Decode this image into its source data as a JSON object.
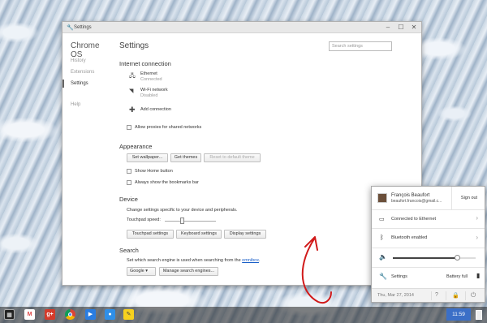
{
  "window": {
    "title": "Settings",
    "controls": {
      "minimize": "–",
      "maximize": "☐",
      "close": "✕"
    }
  },
  "sidebar": {
    "brand": "Chrome OS",
    "items": [
      {
        "label": "History",
        "active": false
      },
      {
        "label": "Extensions",
        "active": false
      },
      {
        "label": "Settings",
        "active": true
      },
      {
        "label": "Help",
        "active": false
      }
    ]
  },
  "main": {
    "title": "Settings",
    "search_placeholder": "Search settings",
    "internet": {
      "heading": "Internet connection",
      "ethernet_name": "Ethernet",
      "ethernet_status": "Connected",
      "wifi_name": "Wi-Fi network",
      "wifi_status": "Disabled",
      "add_connection": "Add connection",
      "allow_proxies": "Allow proxies for shared networks"
    },
    "appearance": {
      "heading": "Appearance",
      "set_wallpaper": "Set wallpaper...",
      "get_themes": "Get themes",
      "reset_theme": "Reset to default theme",
      "show_home": "Show Home button",
      "show_bookmarks": "Always show the bookmarks bar"
    },
    "device": {
      "heading": "Device",
      "description": "Change settings specific to your device and peripherals.",
      "touchpad_speed": "Touchpad speed:",
      "touchpad_speed_value": 0.35,
      "touchpad_settings": "Touchpad settings",
      "keyboard_settings": "Keyboard settings",
      "display_settings": "Display settings"
    },
    "search": {
      "heading": "Search",
      "description_prefix": "Set which search engine is used when searching from the ",
      "description_link": "omnibox",
      "description_suffix": ".",
      "engine": "Google",
      "manage": "Manage search engines..."
    }
  },
  "tray": {
    "user_name": "François Beaufort",
    "user_email": "beaufort.francois@gmail.c...",
    "sign_out": "Sign out",
    "ethernet": "Connected to Ethernet",
    "bluetooth": "Bluetooth enabled",
    "volume_level": 0.78,
    "settings": "Settings",
    "battery": "Battery full",
    "date": "Thu, Mar 27, 2014",
    "help_icon": "?",
    "power_icon": "⏻",
    "lock_icon": "🔒"
  },
  "shelf": {
    "time": "11:59",
    "apps": [
      "launcher",
      "gmail",
      "google-plus",
      "chrome",
      "video",
      "camera",
      "keep"
    ]
  },
  "colors": {
    "accent": "#3b6fc7",
    "arrow": "#d11a1a",
    "link": "#1a5fc8"
  }
}
